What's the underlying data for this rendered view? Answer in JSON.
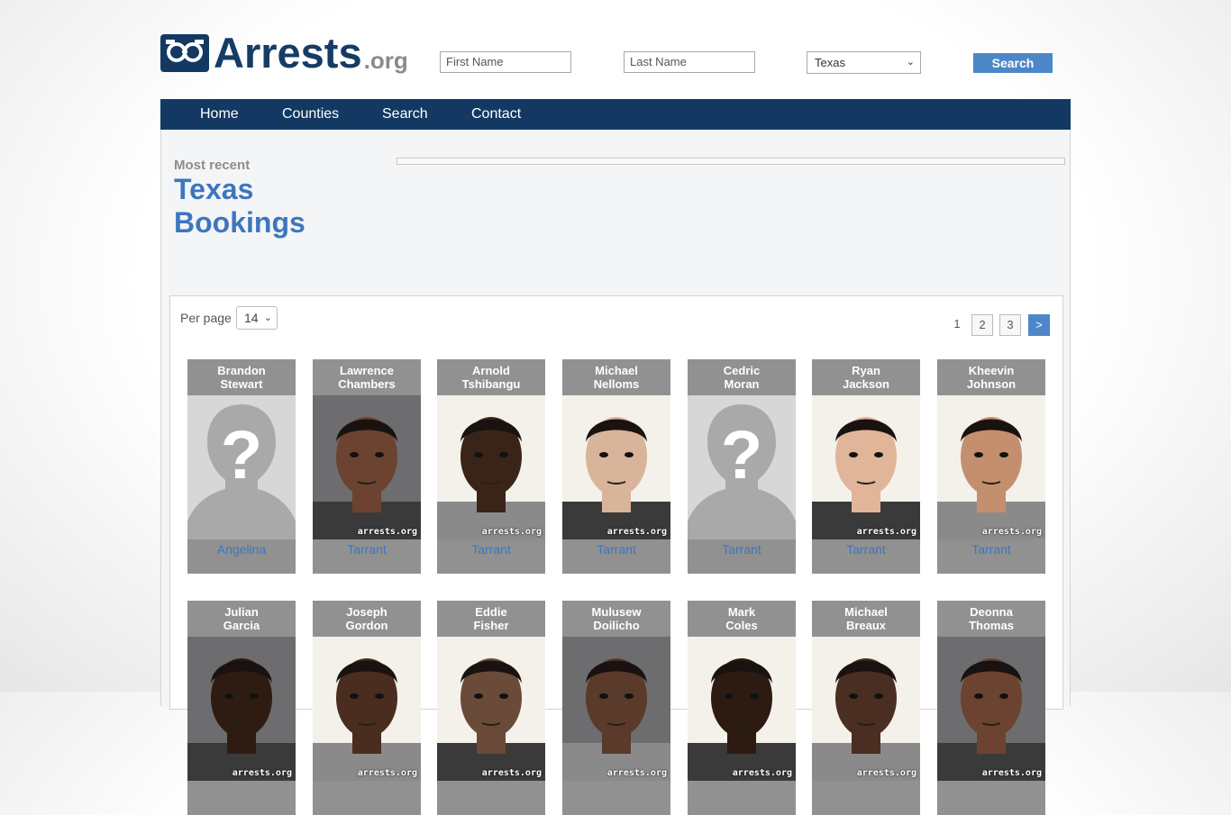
{
  "header": {
    "logo_text": "Arrests",
    "logo_suffix": ".org",
    "first_name_placeholder": "First Name",
    "last_name_placeholder": "Last Name",
    "state_selected": "Texas",
    "search_label": "Search"
  },
  "nav": {
    "items": [
      "Home",
      "Counties",
      "Search",
      "Contact"
    ]
  },
  "intro": {
    "kicker": "Most recent",
    "title_line1": "Texas",
    "title_line2": "Bookings"
  },
  "list": {
    "per_page_label": "Per page",
    "per_page_value": "14",
    "pages": [
      "1",
      "2",
      "3",
      ">"
    ],
    "watermark": "arrests.org",
    "bookings": [
      {
        "first": "Brandon",
        "last": "Stewart",
        "county": "Angelina",
        "photo": "placeholder-silhouette-icon"
      },
      {
        "first": "Lawrence",
        "last": "Chambers",
        "county": "Tarrant",
        "photo": "mugshot"
      },
      {
        "first": "Arnold",
        "last": "Tshibangu",
        "county": "Tarrant",
        "photo": "mugshot"
      },
      {
        "first": "Michael",
        "last": "Nelloms",
        "county": "Tarrant",
        "photo": "mugshot"
      },
      {
        "first": "Cedric",
        "last": "Moran",
        "county": "Tarrant",
        "photo": "placeholder-silhouette-icon"
      },
      {
        "first": "Ryan",
        "last": "Jackson",
        "county": "Tarrant",
        "photo": "mugshot"
      },
      {
        "first": "Kheevin",
        "last": "Johnson",
        "county": "Tarrant",
        "photo": "mugshot"
      },
      {
        "first": "Julian",
        "last": "Garcia",
        "county": "",
        "photo": "mugshot"
      },
      {
        "first": "Joseph",
        "last": "Gordon",
        "county": "",
        "photo": "mugshot"
      },
      {
        "first": "Eddie",
        "last": "Fisher",
        "county": "",
        "photo": "mugshot"
      },
      {
        "first": "Mulusew",
        "last": "Doilicho",
        "county": "",
        "photo": "mugshot"
      },
      {
        "first": "Mark",
        "last": "Coles",
        "county": "",
        "photo": "mugshot"
      },
      {
        "first": "Michael",
        "last": "Breaux",
        "county": "",
        "photo": "mugshot"
      },
      {
        "first": "Deonna",
        "last": "Thomas",
        "county": "",
        "photo": "mugshot"
      }
    ]
  },
  "colors": {
    "brand_navy": "#133963",
    "accent_blue": "#4d87c7",
    "link_blue": "#3d76bd",
    "card_gray": "#919191"
  }
}
